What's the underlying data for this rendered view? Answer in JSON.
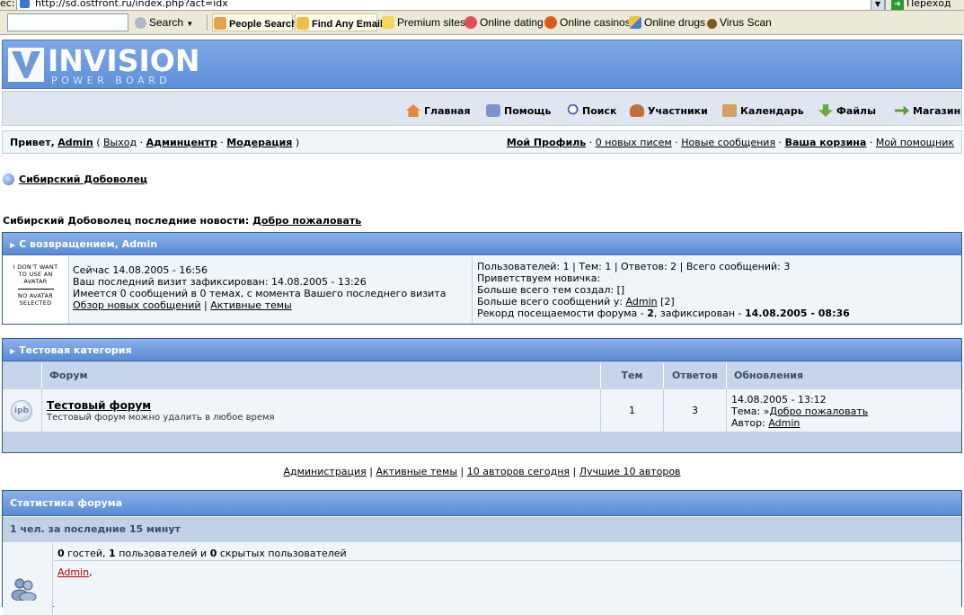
{
  "browser": {
    "address_label": "ес:",
    "url": "http://sd.ostfront.ru/index.php?act=idx",
    "go_label": "Переход",
    "toolbar": {
      "search_label": "Search",
      "items": [
        "People Search",
        "Find Any Email",
        "Premium sites",
        "Online dating",
        "Online casinos",
        "Online drugs",
        "Virus Scan"
      ]
    }
  },
  "forum": {
    "logo_main": "INVISION",
    "logo_sub": "POWER BOARD",
    "nav": [
      "Главная",
      "Помощь",
      "Поиск",
      "Участники",
      "Календарь",
      "Файлы",
      "Магазин"
    ],
    "userbar": {
      "greeting": "Привет,",
      "username": "Admin",
      "logout": "Выход",
      "admincp": "Админцентр",
      "moderation": "Модерация",
      "my_profile": "Мой Профиль",
      "new_messages": "0 новых писем",
      "new_posts": "Новые сообщения",
      "cart": "Ваша корзина",
      "assistant": "Мой помощник"
    },
    "breadcrumb": "Сибирский Добоволец",
    "news": {
      "prefix": "Сибирский Добоволец последние новости:",
      "link": "Добро пожаловать"
    },
    "welcome": {
      "title": "С возвращением, Admin",
      "avatar_text_1": "I DON'T WANT TO USE AN AVATAR",
      "avatar_text_2": "NO AVATAR SELECTED",
      "now": "Сейчас 14.08.2005 - 16:56",
      "last_visit": "Ваш последний визит зафиксирован: 14.08.2005 - 13:26",
      "since": "Имеется 0 сообщений в 0 темах, с момента Вашего последнего визита",
      "new_posts_link": "Обзор новых сообщений",
      "active_topics_link": "Активные темы",
      "stats_line1": "Пользователей: 1 | Тем: 1 | Ответов: 2 | Всего сообщений: 3",
      "stats_line2": "Приветствуем новичка:",
      "stats_line3": "Больше всего тем создал: []",
      "stats_line4_prefix": "Больше всего сообщений у:",
      "stats_line4_user": "Admin",
      "stats_line4_suffix": "[2]",
      "stats_line5_prefix": "Рекорд посещаемости форума -",
      "stats_line5_count": "2",
      "stats_line5_mid": ", зафиксирован -",
      "stats_line5_date": "14.08.2005 - 08:36"
    },
    "category": {
      "title": "Тестовая категория",
      "headers": {
        "forum": "Форум",
        "topics": "Тем",
        "replies": "Ответов",
        "updates": "Обновления"
      },
      "row": {
        "icon": "ipb",
        "name": "Тестовый форум",
        "desc": "Тестовый форум можно удалить в любое время",
        "topics": "1",
        "replies": "3",
        "last_date": "14.08.2005 - 13:12",
        "last_topic_label": "Тема:",
        "last_topic_link": "Добро пожаловать",
        "last_author_label": "Автор:",
        "last_author": "Admin"
      }
    },
    "footer_links": [
      "Администрация",
      "Активные темы",
      "10 авторов сегодня",
      "Лучшие 10 авторов"
    ],
    "stats": {
      "title": "Статистика форума",
      "online_header": "1 чел. за последние 15 минут",
      "guests_count": "0",
      "guests_label": "гостей,",
      "users_count": "1",
      "users_label": "пользователей и",
      "hidden_count": "0",
      "hidden_label": "скрытых пользователей",
      "online_user": "Admin",
      "online_user_suffix": ","
    }
  }
}
